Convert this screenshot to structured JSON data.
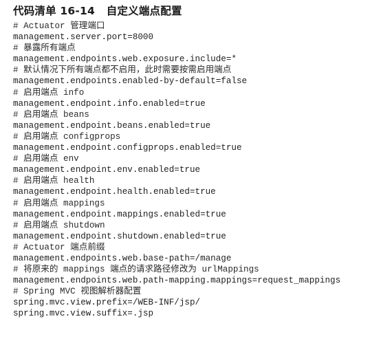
{
  "listing": {
    "title": "代码清单 16-14   自定义端点配置",
    "lines": [
      {
        "kind": "comment",
        "text": "# Actuator 管理端口"
      },
      {
        "kind": "code",
        "text": "management.server.port=8000"
      },
      {
        "kind": "comment",
        "text": "# 暴露所有端点"
      },
      {
        "kind": "code",
        "text": "management.endpoints.web.exposure.include=*"
      },
      {
        "kind": "comment",
        "text": "# 默认情况下所有端点都不启用，此时需要按需启用端点"
      },
      {
        "kind": "code",
        "text": "management.endpoints.enabled-by-default=false"
      },
      {
        "kind": "comment",
        "text": "# 启用端点 info"
      },
      {
        "kind": "code",
        "text": "management.endpoint.info.enabled=true"
      },
      {
        "kind": "comment",
        "text": "# 启用端点 beans"
      },
      {
        "kind": "code",
        "text": "management.endpoint.beans.enabled=true"
      },
      {
        "kind": "comment",
        "text": "# 启用端点 configprops"
      },
      {
        "kind": "code",
        "text": "management.endpoint.configprops.enabled=true"
      },
      {
        "kind": "comment",
        "text": "# 启用端点 env"
      },
      {
        "kind": "code",
        "text": "management.endpoint.env.enabled=true"
      },
      {
        "kind": "comment",
        "text": "# 启用端点 health"
      },
      {
        "kind": "code",
        "text": "management.endpoint.health.enabled=true"
      },
      {
        "kind": "comment",
        "text": "# 启用端点 mappings"
      },
      {
        "kind": "code",
        "text": "management.endpoint.mappings.enabled=true"
      },
      {
        "kind": "comment",
        "text": "# 启用端点 shutdown"
      },
      {
        "kind": "code",
        "text": "management.endpoint.shutdown.enabled=true"
      },
      {
        "kind": "comment",
        "text": "# Actuator 端点前缀"
      },
      {
        "kind": "code",
        "text": "management.endpoints.web.base-path=/manage"
      },
      {
        "kind": "comment",
        "text": "# 将原来的 mappings 端点的请求路径修改为 urlMappings"
      },
      {
        "kind": "code",
        "text": "management.endpoints.web.path-mapping.mappings=request_mappings"
      },
      {
        "kind": "comment",
        "text": "# Spring MVC 视图解析器配置"
      },
      {
        "kind": "code",
        "text": "spring.mvc.view.prefix=/WEB-INF/jsp/"
      },
      {
        "kind": "code",
        "text": "spring.mvc.view.suffix=.jsp"
      }
    ]
  }
}
